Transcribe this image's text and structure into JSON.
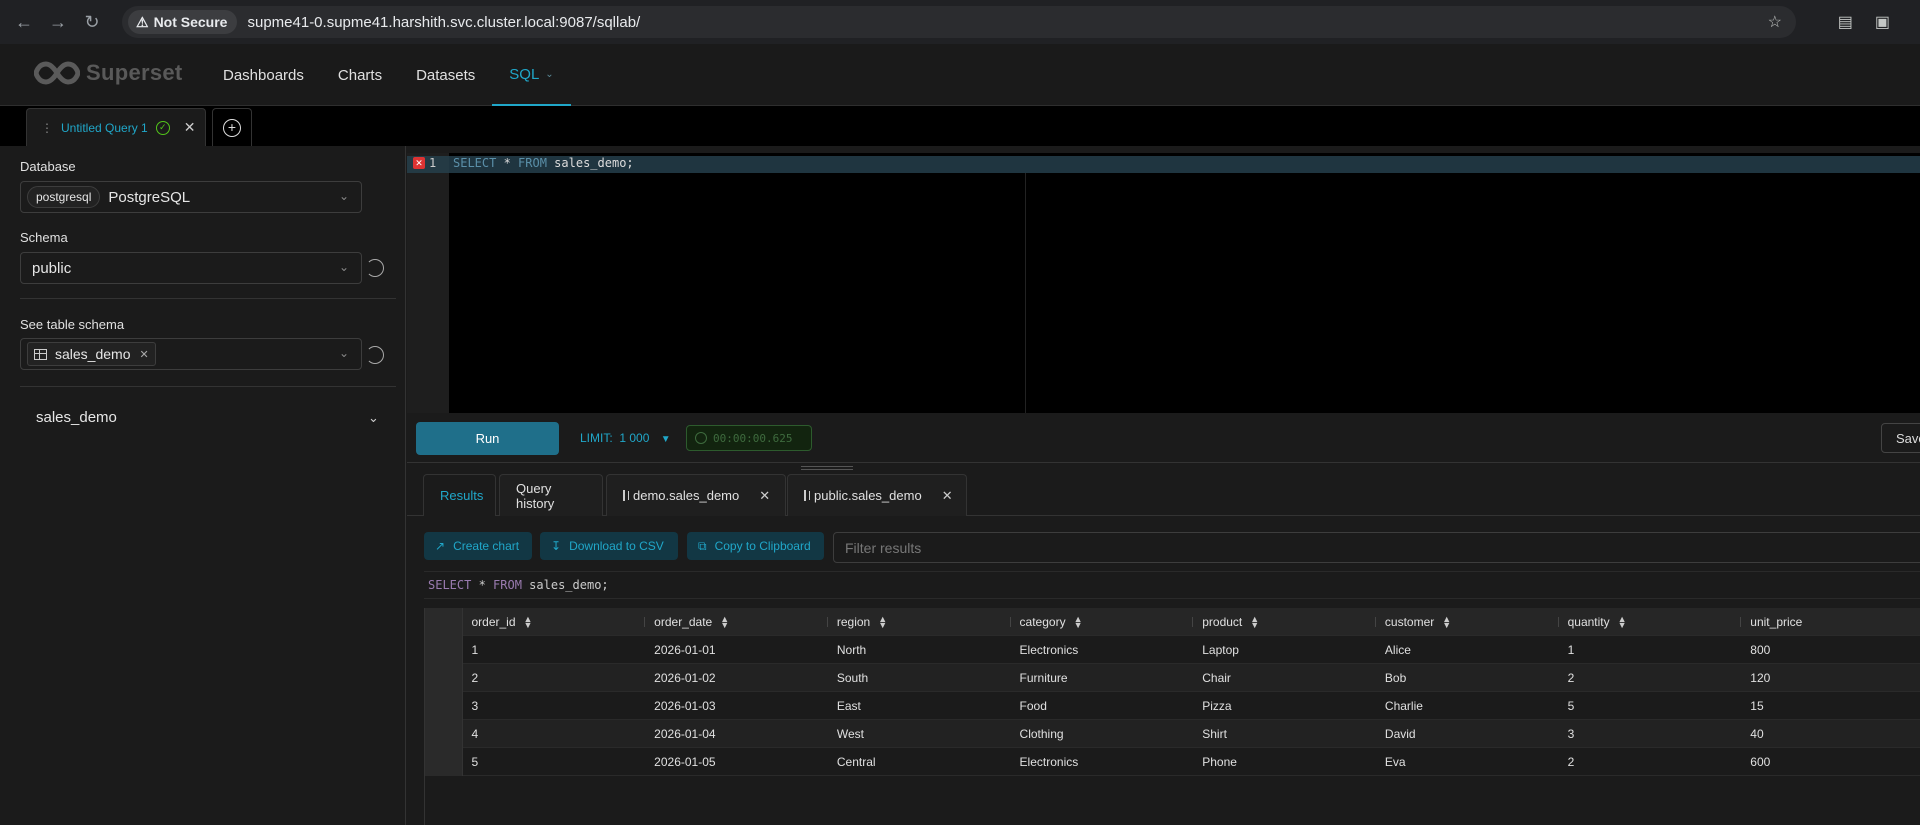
{
  "browser": {
    "not_secure": "Not Secure",
    "url": "supme41-0.supme41.harshith.svc.cluster.local:9087/sqllab/"
  },
  "app": {
    "logo": "Superset",
    "menu": [
      "Dashboards",
      "Charts",
      "Datasets",
      "SQL"
    ],
    "active_menu": "SQL"
  },
  "query_tab": {
    "title": "Untitled Query 1"
  },
  "left": {
    "database_label": "Database",
    "database_tag": "postgresql",
    "database_value": "PostgreSQL",
    "schema_label": "Schema",
    "schema_value": "public",
    "table_label": "See table schema",
    "table_tag": "sales_demo",
    "table_item": "sales_demo"
  },
  "editor": {
    "line_number": "1",
    "sql_keyword1": "SELECT",
    "sql_star": " * ",
    "sql_keyword2": "FROM",
    "sql_rest": " sales_demo;"
  },
  "runbar": {
    "run": "Run",
    "limit": "LIMIT:  1 000",
    "timer": "00:00:00.625",
    "save": "Save"
  },
  "result_tabs": [
    "Results",
    "Query history",
    "demo.sales_demo",
    "public.sales_demo"
  ],
  "actions": {
    "create_chart": "Create chart",
    "download_csv": "Download to CSV",
    "copy_clipboard": "Copy to Clipboard",
    "filter_placeholder": "Filter results"
  },
  "executed_sql": {
    "kw1": "SELECT",
    "mid": " * ",
    "kw2": "FROM",
    "rest": " sales_demo;"
  },
  "grid": {
    "columns": [
      "order_id",
      "order_date",
      "region",
      "category",
      "product",
      "customer",
      "quantity",
      "unit_price"
    ],
    "rows": [
      [
        "1",
        "2026-01-01",
        "North",
        "Electronics",
        "Laptop",
        "Alice",
        "1",
        "800"
      ],
      [
        "2",
        "2026-01-02",
        "South",
        "Furniture",
        "Chair",
        "Bob",
        "2",
        "120"
      ],
      [
        "3",
        "2026-01-03",
        "East",
        "Food",
        "Pizza",
        "Charlie",
        "5",
        "15"
      ],
      [
        "4",
        "2026-01-04",
        "West",
        "Clothing",
        "Shirt",
        "David",
        "3",
        "40"
      ],
      [
        "5",
        "2026-01-05",
        "Central",
        "Electronics",
        "Phone",
        "Eva",
        "2",
        "600"
      ]
    ]
  }
}
